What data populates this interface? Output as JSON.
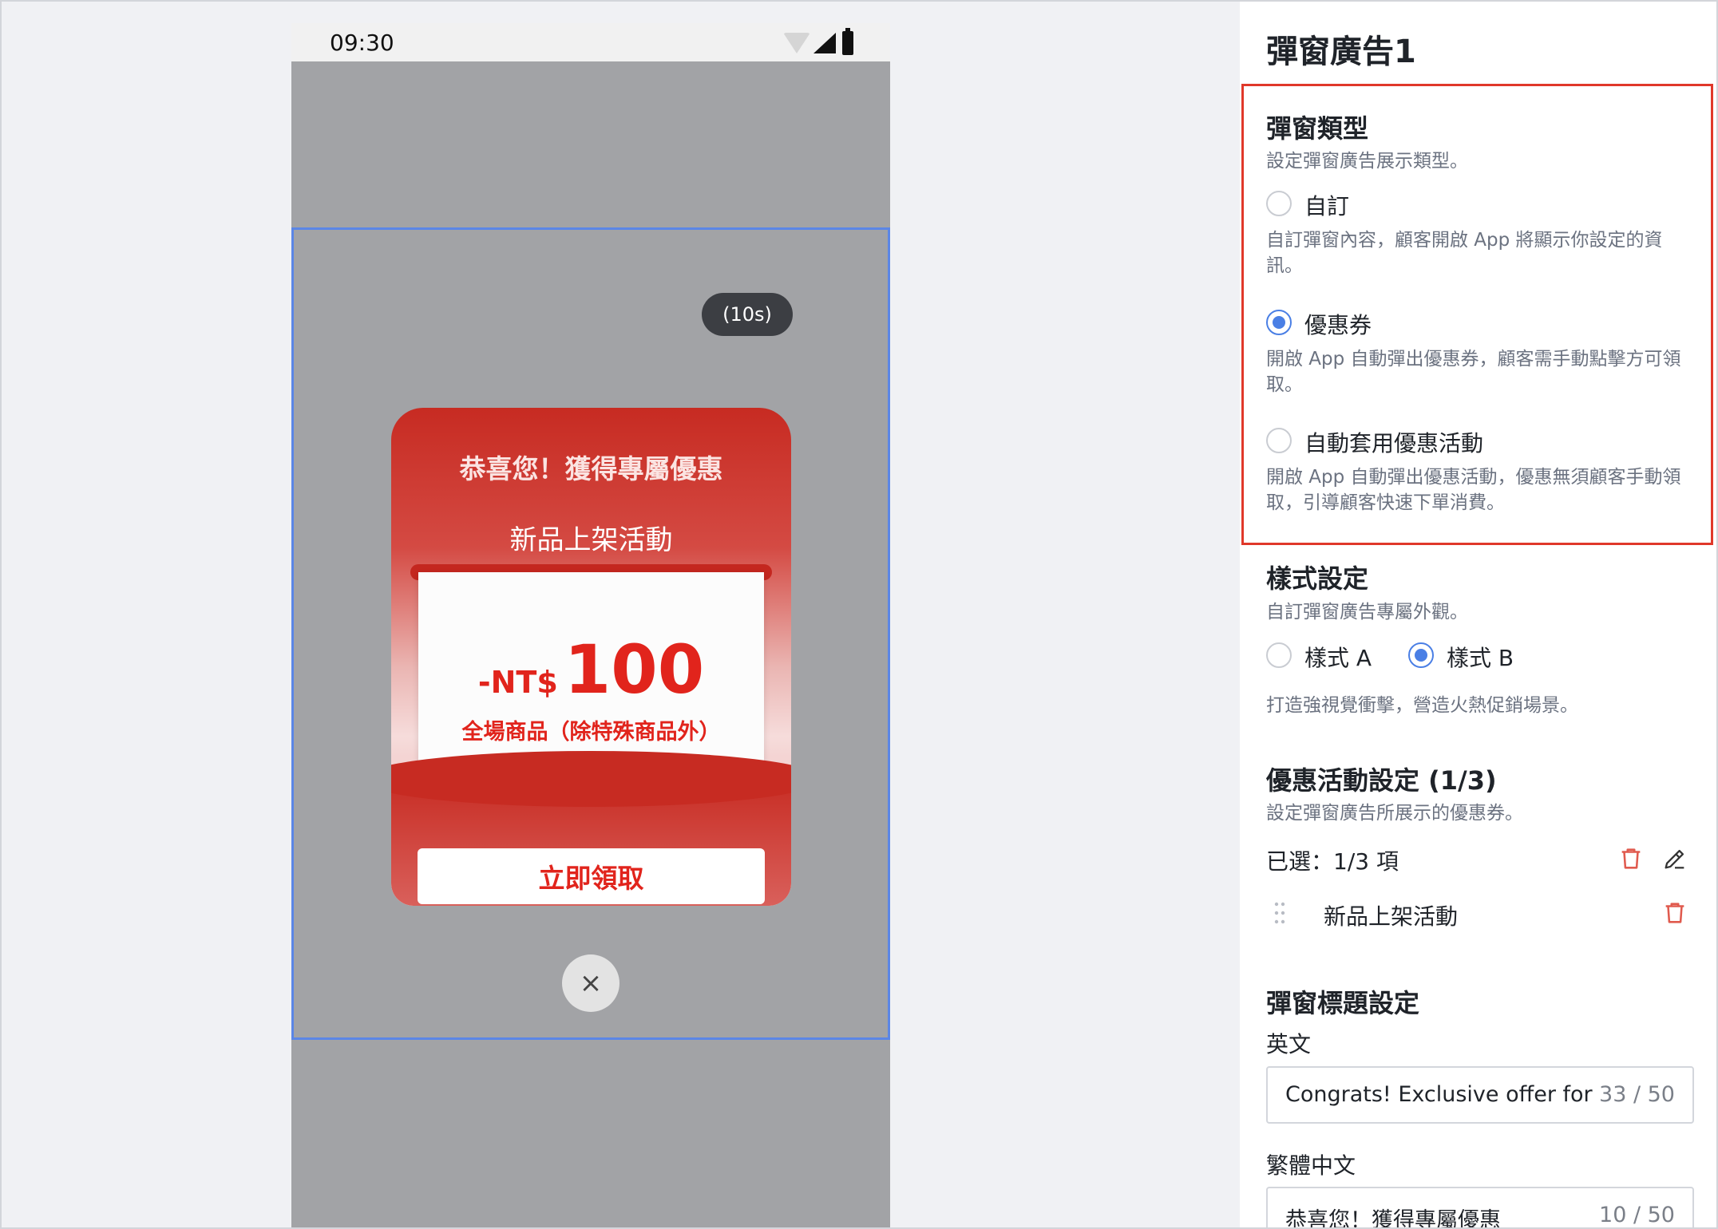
{
  "colors": {
    "accent": "#4a7fe5",
    "highlight_border": "#e0382a",
    "coupon_red": "#e1241c",
    "delete_red": "#e05a4e"
  },
  "phone": {
    "status_time": "09:30",
    "icons": [
      "wifi-icon",
      "signal-icon",
      "battery-icon"
    ]
  },
  "popup": {
    "countdown": "(10s)",
    "heading": "恭喜您！獲得專屬優惠",
    "campaign_title": "新品上架活動",
    "amount_prefix": "-NT$",
    "amount_value": "100",
    "coupon_note": "全場商品（除特殊商品外）",
    "claim_label": "立即領取",
    "close_symbol": "×"
  },
  "panel": {
    "title": "彈窗廣告1",
    "popup_type": {
      "title": "彈窗類型",
      "description": "設定彈窗廣告展示類型。",
      "options": [
        {
          "label": "自訂",
          "description": "自訂彈窗內容，顧客開啟 App 將顯示你設定的資訊。",
          "selected": false
        },
        {
          "label": "優惠券",
          "description": "開啟 App 自動彈出優惠券，顧客需手動點擊方可領取。",
          "selected": true
        },
        {
          "label": "自動套用優惠活動",
          "description": "開啟 App 自動彈出優惠活動，優惠無須顧客手動領取，引導顧客快速下單消費。",
          "selected": false
        }
      ]
    },
    "style": {
      "title": "樣式設定",
      "description": "自訂彈窗廣告專屬外觀。",
      "options": [
        {
          "label": "樣式 A",
          "selected": false
        },
        {
          "label": "樣式 B",
          "selected": true
        }
      ],
      "hint": "打造強視覺衝擊，營造火熱促銷場景。"
    },
    "campaign": {
      "title": "優惠活動設定 (1/3)",
      "description": "設定彈窗廣告所展示的優惠券。",
      "selected_summary": "已選：1/3 項",
      "items": [
        "新品上架活動"
      ]
    },
    "title_settings": {
      "title": "彈窗標題設定",
      "fields": [
        {
          "label": "英文",
          "value": "Congrats! Exclusive offer for you",
          "count": "33 / 50"
        },
        {
          "label": "繁體中文",
          "value": "恭喜您！獲得專屬優惠",
          "count": "10 / 50"
        }
      ]
    }
  }
}
